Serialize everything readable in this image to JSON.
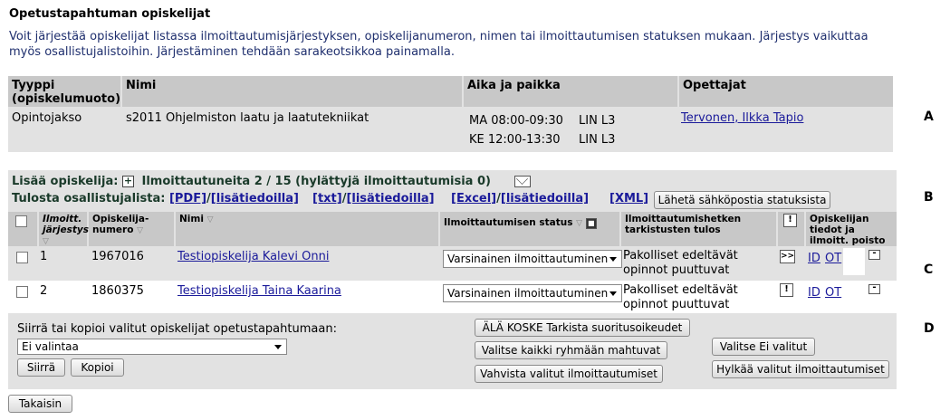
{
  "page": {
    "title": "Opetustapahtuman opiskelijat",
    "intro": "Voit järjestää opiskelijat listassa ilmoittautumisjärjestyksen, opiskelijanumeron, nimen tai ilmoittautumisen statuksen mukaan. Järjestys vaikuttaa myös osallistujalistoihin. Järjestäminen tehdään sarakeotsikkoa painamalla."
  },
  "side_labels": {
    "a": "A",
    "b": "B",
    "c": "C",
    "d": "D"
  },
  "event": {
    "headers": {
      "type": "Tyyppi",
      "type_sub": "(opiskelumuoto)",
      "name": "Nimi",
      "time_place": "Aika ja paikka",
      "teachers": "Opettajat"
    },
    "type": "Opintojakso",
    "name": "s2011 Ohjelmiston laatu ja laatutekniikat",
    "times": [
      {
        "slot": "MA 08:00-09:30",
        "room": "LIN L3"
      },
      {
        "slot": "KE 12:00-13:30",
        "room": "LIN L3"
      }
    ],
    "teacher": "Tervonen, Ilkka Tapio"
  },
  "students": {
    "add_label": "Lisää opiskelija:",
    "registered_text": "Ilmoittautuneita 2 / 15 (hylättyjä ilmoittautumisia 0)",
    "print_label": "Tulosta osallistujalista:",
    "links": {
      "pdf": "[PDF]",
      "txt": "[txt]",
      "excel": "[Excel]",
      "extra": "[lisätiedoilla]",
      "xml": "[XML]",
      "slash": "/"
    },
    "email_button": "Lähetä sähköpostia statuksista",
    "columns": {
      "order": "Ilmoitt. järjestys",
      "number": "Opiskelija-numero",
      "name": "Nimi",
      "status": "Ilmoittautumisen status",
      "check": "Ilmoittautumishetken tarkistusten tulos",
      "remove": "Opiskelijan tiedot ja ilmoitt. poisto"
    },
    "rows": [
      {
        "order": "1",
        "number": "1967016",
        "name": "Testiopiskelija Kalevi Onni",
        "status": "Varsinainen ilmoittautuminen",
        "check": "Pakolliset edeltävät opinnot puuttuvat",
        "flag": ">>",
        "id": "ID",
        "ot": "OT"
      },
      {
        "order": "2",
        "number": "1860375",
        "name": "Testiopiskelija Taina Kaarina",
        "status": "Varsinainen ilmoittautuminen",
        "check": "Pakolliset edeltävät opinnot puuttuvat",
        "flag": "!",
        "id": "ID",
        "ot": "OT"
      }
    ]
  },
  "actions": {
    "move_label": "Siirrä tai kopioi valitut opiskelijat opetustapahtumaan:",
    "select_value": "Ei valintaa",
    "move_button": "Siirrä",
    "copy_button": "Kopioi",
    "check_button": "ÄLÄ KOSKE Tarkista suoritusoikeudet",
    "select_fit_button": "Valitse kaikki ryhmään mahtuvat",
    "confirm_button": "Vahvista valitut ilmoittautumiset",
    "select_none_button": "Valitse Ei valitut",
    "reject_button": "Hylkää valitut ilmoittautumiset"
  },
  "back_button": "Takaisin"
}
